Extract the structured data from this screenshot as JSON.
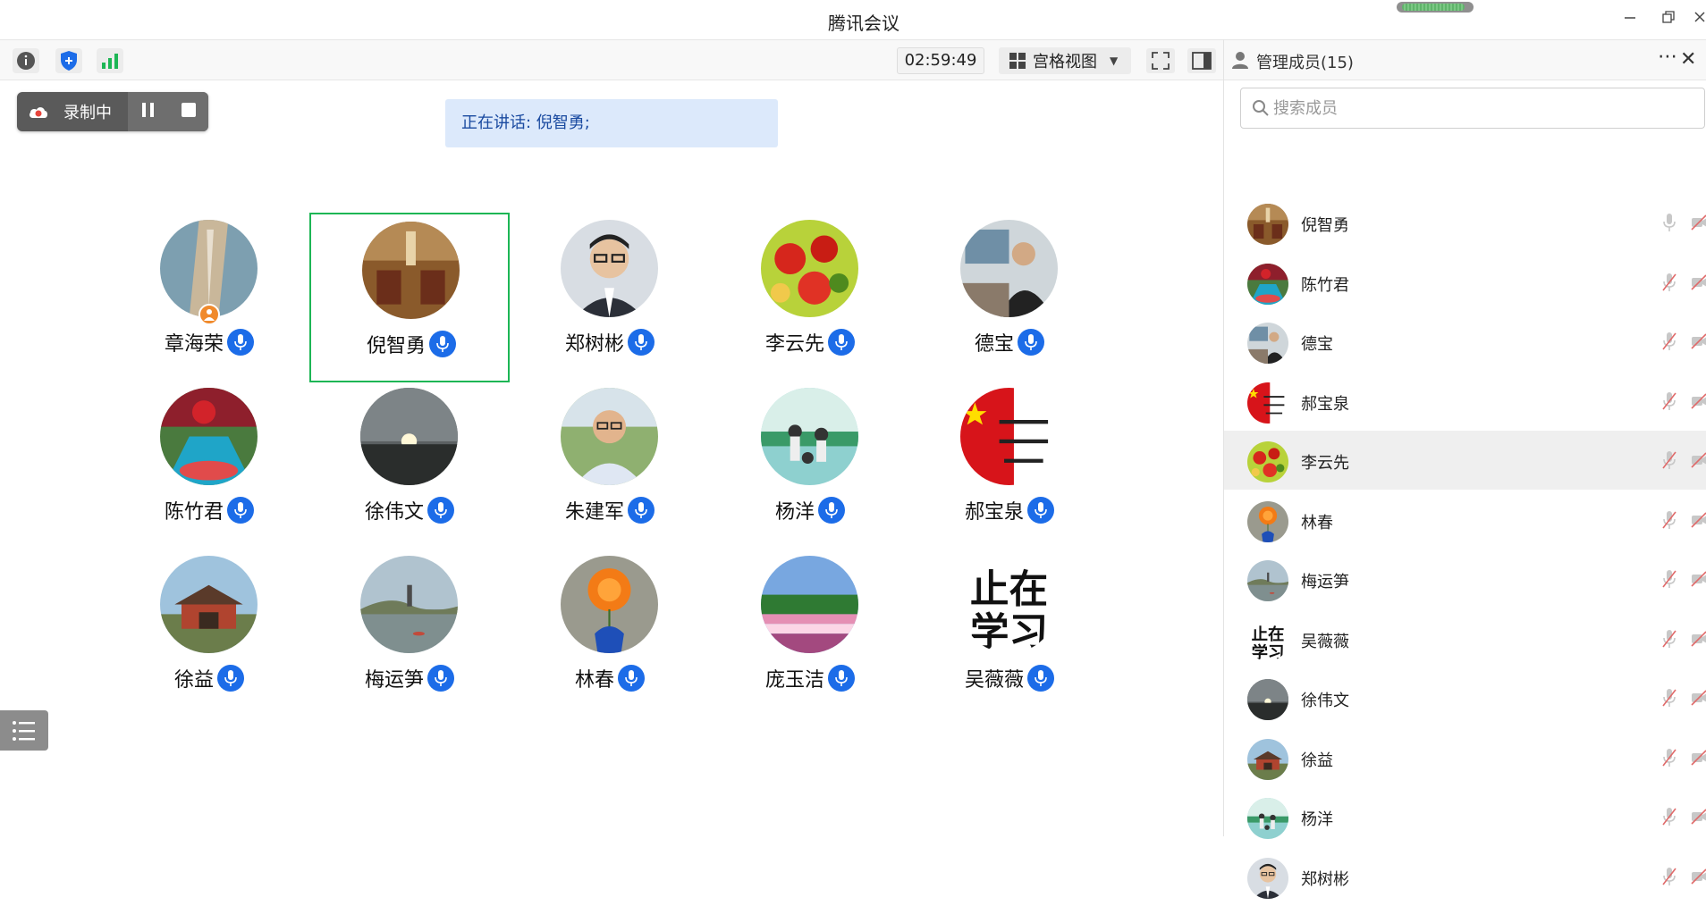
{
  "window": {
    "title": "腾讯会议"
  },
  "toolbar": {
    "timer": "02:59:49",
    "view_label": "宫格视图"
  },
  "recording": {
    "label": "录制中"
  },
  "speaking": {
    "text": "正在讲话: 倪智勇;"
  },
  "grid": [
    {
      "name": "章海荣",
      "avatar": "coast"
    },
    {
      "name": "倪智勇",
      "avatar": "room",
      "active": true
    },
    {
      "name": "郑树彬",
      "avatar": "man"
    },
    {
      "name": "李云先",
      "avatar": "fruit"
    },
    {
      "name": "德宝",
      "avatar": "office"
    },
    {
      "name": "陈竹君",
      "avatar": "garden"
    },
    {
      "name": "徐伟文",
      "avatar": "sunset"
    },
    {
      "name": "朱建军",
      "avatar": "man2"
    },
    {
      "name": "杨洋",
      "avatar": "family"
    },
    {
      "name": "郝宝泉",
      "avatar": "flag"
    },
    {
      "name": "徐益",
      "avatar": "temple"
    },
    {
      "name": "梅运笋",
      "avatar": "lake"
    },
    {
      "name": "林春",
      "avatar": "flower"
    },
    {
      "name": "庞玉洁",
      "avatar": "field"
    },
    {
      "name": "吴薇薇",
      "avatar": "text"
    }
  ],
  "sidebar": {
    "title": "管理成员(15)",
    "search_placeholder": "搜索成员",
    "members": [
      {
        "name": "倪智勇",
        "avatar": "room",
        "mic_on": true
      },
      {
        "name": "陈竹君",
        "avatar": "garden"
      },
      {
        "name": "德宝",
        "avatar": "office"
      },
      {
        "name": "郝宝泉",
        "avatar": "flag"
      },
      {
        "name": "李云先",
        "avatar": "fruit",
        "selected": true
      },
      {
        "name": "林春",
        "avatar": "flower"
      },
      {
        "name": "梅运笋",
        "avatar": "lake"
      },
      {
        "name": "吴薇薇",
        "avatar": "text"
      },
      {
        "name": "徐伟文",
        "avatar": "sunset"
      },
      {
        "name": "徐益",
        "avatar": "temple"
      },
      {
        "name": "杨洋",
        "avatar": "family"
      },
      {
        "name": "郑树彬",
        "avatar": "man"
      }
    ]
  },
  "colors": {
    "accent": "#1c6ce8",
    "active_border": "#1db655",
    "host_badge": "#f08a2c",
    "banner": "#dce9fb"
  }
}
